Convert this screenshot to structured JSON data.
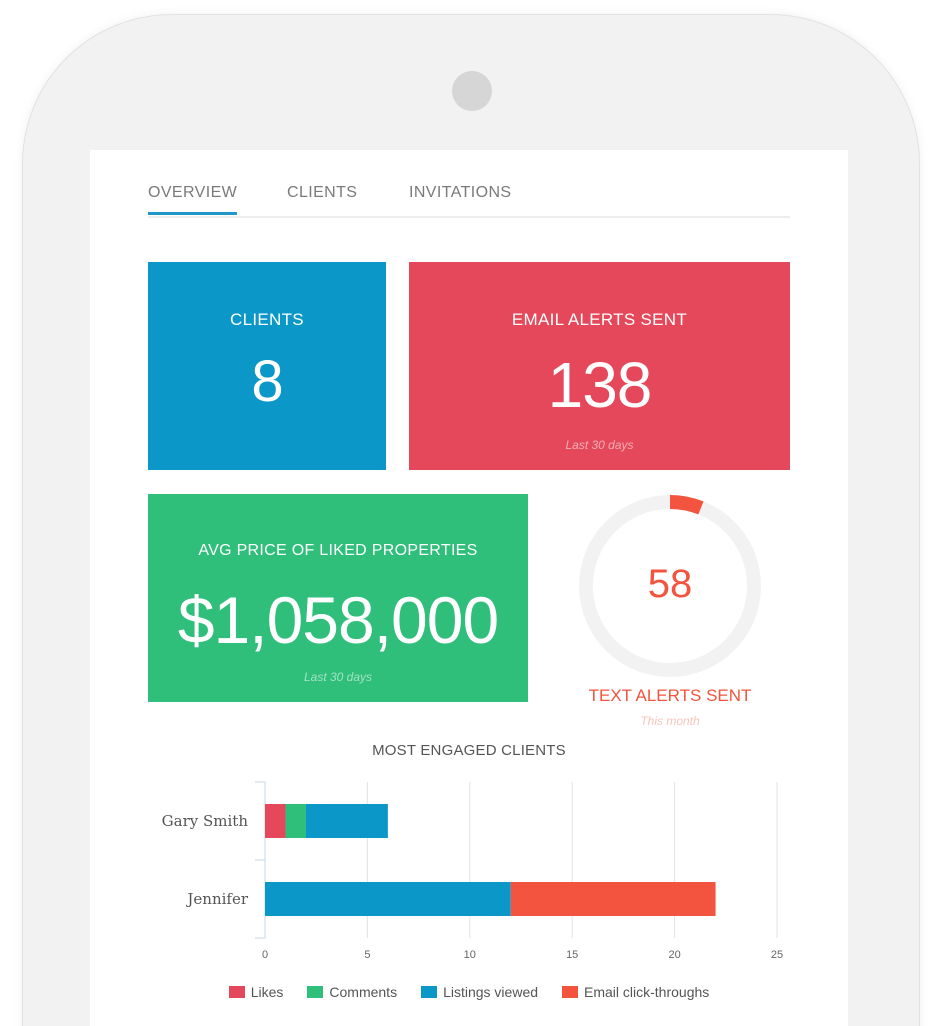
{
  "tabs": [
    {
      "label": "OVERVIEW",
      "active": true
    },
    {
      "label": "CLIENTS",
      "active": false
    },
    {
      "label": "INVITATIONS",
      "active": false
    }
  ],
  "cards": {
    "clients": {
      "label": "CLIENTS",
      "value": "8"
    },
    "email_alerts": {
      "label": "EMAIL ALERTS SENT",
      "value": "138",
      "sub": "Last 30 days"
    },
    "avg_price": {
      "label": "AVG PRICE OF LIKED PROPERTIES",
      "value": "$1,058,000",
      "sub": "Last 30 days"
    }
  },
  "gauge": {
    "value": "58",
    "title": "TEXT ALERTS SENT",
    "sub": "This month",
    "fraction": 0.06,
    "color": "#f2543f",
    "track_color": "#f2f2f2"
  },
  "colors": {
    "clients": "#0b98c9",
    "email": "#e4485a",
    "avg": "#2fbf7b",
    "tab_accent": "#2196c7"
  },
  "chart_data": {
    "type": "bar",
    "orientation": "horizontal",
    "stacked": true,
    "title": "MOST ENGAGED CLIENTS",
    "categories": [
      "Gary Smith",
      "Jennifer"
    ],
    "series": [
      {
        "name": "Likes",
        "color": "#e4485a",
        "values": [
          1,
          0
        ]
      },
      {
        "name": "Comments",
        "color": "#2fbf7b",
        "values": [
          1,
          0
        ]
      },
      {
        "name": "Listings viewed",
        "color": "#0b98c9",
        "values": [
          4,
          12
        ]
      },
      {
        "name": "Email click-throughs",
        "color": "#f2543f",
        "values": [
          0,
          10
        ]
      }
    ],
    "xlim": [
      0,
      25
    ],
    "xticks": [
      0,
      5,
      10,
      15,
      20,
      25
    ],
    "grid": true,
    "legend": "bottom"
  }
}
